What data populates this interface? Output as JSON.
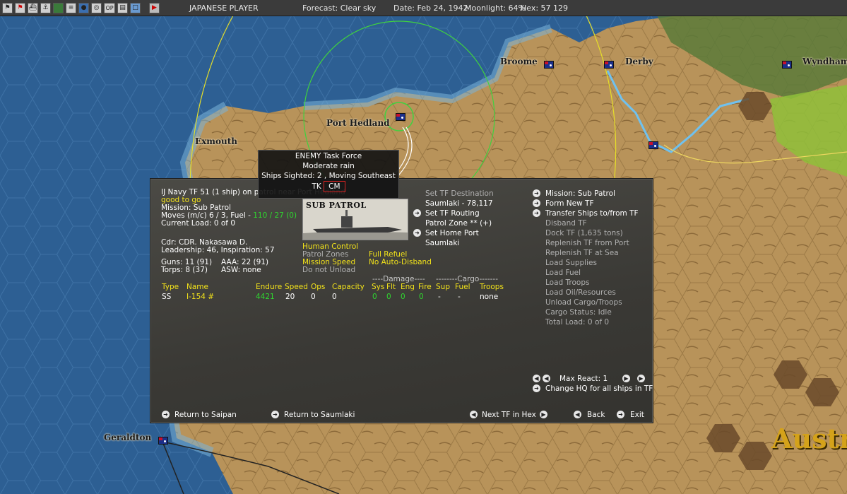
{
  "topbar": {
    "player": "JAPANESE PLAYER",
    "forecast": "Forecast: Clear sky",
    "date": "Date: Feb 24, 1942",
    "moonlight": "Moonlight: 64%",
    "hex": "Hex: 57 129",
    "icons": [
      "flag-icon",
      "flag-red-icon",
      "ship-icon",
      "anchor-icon",
      "unit-icon",
      "list-icon",
      "globe-icon",
      "target-icon",
      "op-icon",
      "report-icon",
      "window-icon",
      "play-icon"
    ],
    "op_label": "OP"
  },
  "map": {
    "cities": [
      "Broome",
      "Derby",
      "Wyndham",
      "Port Hedland",
      "Exmouth",
      "Geraldton"
    ],
    "region": "Austra"
  },
  "tooltip": {
    "line1": "ENEMY Task Force",
    "line2": "Moderate rain",
    "line3": "Ships Sighted: 2 , Moving Southeast",
    "line4_prefix": "TK",
    "line4_box": "CM"
  },
  "panel": {
    "header": "IJ Navy TF 51 (1 ship)  on patrol near Port Hedland",
    "status": "good to go",
    "mission": "Mission: Sub Patrol",
    "moves_prefix": "Moves (m/c) 6 / 3, Fuel - ",
    "fuel": "110 / 27 (0)",
    "current_load": "Current Load: 0 of 0",
    "image_label": "SUB PATROL",
    "commander": "Cdr: CDR. Nakasawa D.",
    "leadership": "Leadership: 46, Inspiration: 57",
    "guns": "Guns: 11 (91)",
    "aaa": "AAA: 22 (91)",
    "torps": "Torps: 8 (37)",
    "asw": "ASW: none",
    "options": {
      "human_control": "Human Control",
      "patrol_zones": "Patrol Zones",
      "mission_speed": "Mission Speed",
      "do_not_unload": "Do not Unload",
      "full_refuel": "Full Refuel",
      "no_auto_disband": "No Auto-Disband"
    },
    "destination": {
      "set_tf_destination": "Set TF Destination",
      "destination_value": "Saumlaki - 78,117",
      "set_tf_routing": "Set TF Routing",
      "patrol_zone": "Patrol Zone ** (+)",
      "set_home_port": "Set Home Port",
      "home_port_value": "Saumlaki"
    },
    "table": {
      "damage_header": "----Damage----",
      "cargo_header": "--------Cargo-------",
      "headers": [
        "Type",
        "Name",
        "Endure",
        "Speed",
        "Ops",
        "Capacity",
        "Sys",
        "Flt",
        "Eng",
        "Fire",
        "Sup",
        "Fuel",
        "Troops"
      ],
      "rows": [
        [
          "SS",
          "I-154 #",
          "4421",
          "20",
          "0",
          "0",
          "0",
          "0",
          "0",
          "0",
          "-",
          "-",
          "none"
        ]
      ]
    },
    "right_menu": {
      "mission": "Mission: Sub Patrol",
      "form_new_tf": "Form New TF",
      "transfer_ships": "Transfer Ships to/from TF",
      "disband_tf": "Disband TF",
      "dock_tf": "Dock TF (1,635 tons)",
      "replenish_port": "Replenish TF from Port",
      "replenish_sea": "Replenish TF at Sea",
      "load_supplies": "Load Supplies",
      "load_fuel": "Load Fuel",
      "load_troops": "Load Troops",
      "load_oil": "Load Oil/Resources",
      "unload_cargo": "Unload Cargo/Troops",
      "cargo_status": "Cargo Status: Idle",
      "total_load": "Total Load: 0 of 0"
    },
    "max_react": "Max React:  1",
    "change_hq": "Change HQ for all ships in TF",
    "bottom": {
      "return_saipan": "Return to Saipan",
      "return_saumlaki": "Return to Saumlaki",
      "next_tf": "Next TF in Hex",
      "back": "Back",
      "exit": "Exit"
    }
  }
}
